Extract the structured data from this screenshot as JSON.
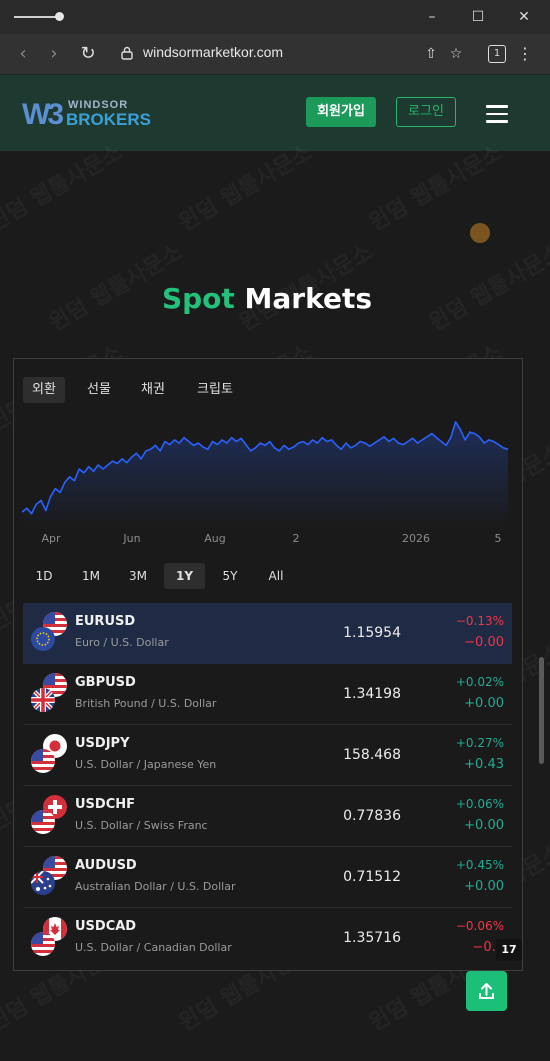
{
  "browser": {
    "url": "windsormarketkor.com",
    "tab_count": "1"
  },
  "site": {
    "logo_mark": "W3",
    "logo_top": "WINDSOR",
    "logo_bottom": "BROKERS",
    "signup_label": "회원가입",
    "login_label": "로그인",
    "watermark": "윈덤 웹툴사문소"
  },
  "section": {
    "title_accent": "Spot",
    "title_rest": "Markets"
  },
  "categories": [
    {
      "label": "외환",
      "active": true
    },
    {
      "label": "선물",
      "active": false
    },
    {
      "label": "채권",
      "active": false
    },
    {
      "label": "크립토",
      "active": false
    }
  ],
  "ranges": [
    {
      "label": "1D",
      "active": false
    },
    {
      "label": "1M",
      "active": false
    },
    {
      "label": "3M",
      "active": false
    },
    {
      "label": "1Y",
      "active": true
    },
    {
      "label": "5Y",
      "active": false
    },
    {
      "label": "All",
      "active": false
    }
  ],
  "chart_data": {
    "type": "area",
    "x_tick_labels": [
      "Apr",
      "Jun",
      "Aug",
      "2",
      "2026",
      "5"
    ],
    "line_color": "#2962ff",
    "values": [
      1.08,
      1.085,
      1.078,
      1.09,
      1.095,
      1.082,
      1.1,
      1.11,
      1.105,
      1.118,
      1.125,
      1.12,
      1.135,
      1.13,
      1.138,
      1.132,
      1.14,
      1.135,
      1.14,
      1.145,
      1.142,
      1.148,
      1.143,
      1.15,
      1.155,
      1.148,
      1.158,
      1.16,
      1.165,
      1.158,
      1.17,
      1.166,
      1.172,
      1.168,
      1.175,
      1.17,
      1.165,
      1.168,
      1.163,
      1.16,
      1.17,
      1.166,
      1.172,
      1.168,
      1.175,
      1.17,
      1.174,
      1.166,
      1.158,
      1.162,
      1.168,
      1.165,
      1.17,
      1.162,
      1.158,
      1.165,
      1.16,
      1.163,
      1.168,
      1.17,
      1.166,
      1.172,
      1.168,
      1.175,
      1.17,
      1.172,
      1.165,
      1.16,
      1.168,
      1.162,
      1.165,
      1.17,
      1.168,
      1.164,
      1.168,
      1.172,
      1.176,
      1.17,
      1.174,
      1.168,
      1.166,
      1.17,
      1.174,
      1.168,
      1.172,
      1.176,
      1.18,
      1.175,
      1.17,
      1.165,
      1.175,
      1.195,
      1.185,
      1.172,
      1.182,
      1.18,
      1.176,
      1.168,
      1.172,
      1.17,
      1.166,
      1.162,
      1.16
    ],
    "ylim": [
      1.07,
      1.205
    ],
    "grid": false,
    "legend": "none"
  },
  "pairs": [
    {
      "symbol": "EURUSD",
      "desc": "Euro / U.S. Dollar",
      "price": "1.15954",
      "pct": "−0.13%",
      "abs": "−0.00",
      "dir": "dn",
      "selected": true,
      "flag_back": "us",
      "flag_front": "eu"
    },
    {
      "symbol": "GBPUSD",
      "desc": "British Pound / U.S. Dollar",
      "price": "1.34198",
      "pct": "+0.02%",
      "abs": "+0.00",
      "dir": "up",
      "selected": false,
      "flag_back": "us",
      "flag_front": "gb"
    },
    {
      "symbol": "USDJPY",
      "desc": "U.S. Dollar / Japanese Yen",
      "price": "158.468",
      "pct": "+0.27%",
      "abs": "+0.43",
      "dir": "up",
      "selected": false,
      "flag_back": "jp",
      "flag_front": "us"
    },
    {
      "symbol": "USDCHF",
      "desc": "U.S. Dollar / Swiss Franc",
      "price": "0.77836",
      "pct": "+0.06%",
      "abs": "+0.00",
      "dir": "up",
      "selected": false,
      "flag_back": "ch",
      "flag_front": "us"
    },
    {
      "symbol": "AUDUSD",
      "desc": "Australian Dollar / U.S. Dollar",
      "price": "0.71512",
      "pct": "+0.45%",
      "abs": "+0.00",
      "dir": "up",
      "selected": false,
      "flag_back": "us",
      "flag_front": "au"
    },
    {
      "symbol": "USDCAD",
      "desc": "U.S. Dollar / Canadian Dollar",
      "price": "1.35716",
      "pct": "−0.06%",
      "abs": "−0.0",
      "dir": "dn",
      "selected": false,
      "flag_back": "ca",
      "flag_front": "us"
    }
  ],
  "tv_badge": "17",
  "colors": {
    "accent_green": "#22c27a",
    "header_bg": "#1e3a30",
    "up": "#22ab94",
    "down": "#f23645",
    "selected_row": "#1f2a44"
  }
}
